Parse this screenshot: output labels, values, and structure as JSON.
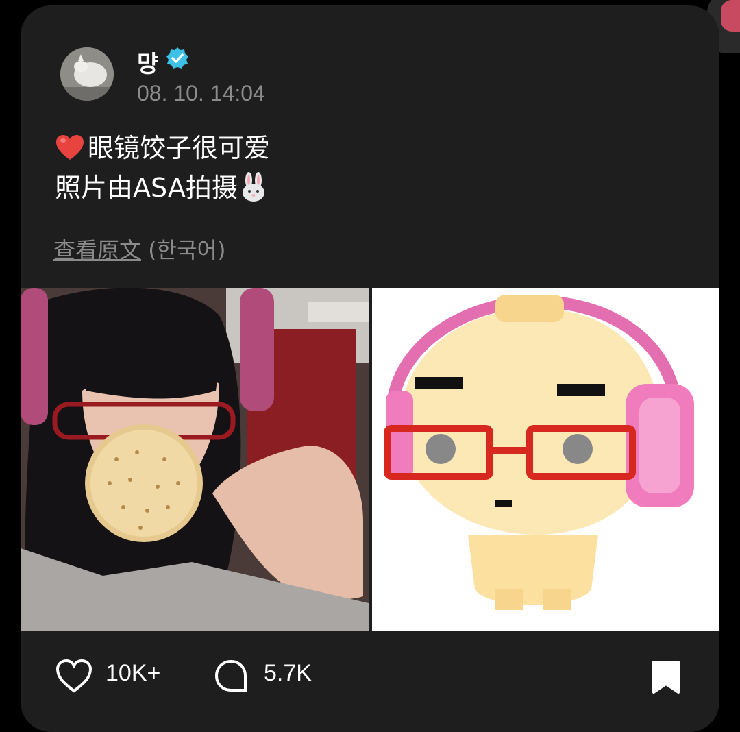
{
  "post": {
    "username": "먕",
    "verified_icon": "verified-badge-icon",
    "timestamp": "08. 10. 14:04",
    "text_line1": "眼镜饺子很可爱",
    "text_line2": "照片由ASA拍摄",
    "emoji_heart": "❤️",
    "emoji_rabbit": "🐰",
    "translate_link": "查看原文",
    "translate_language": "(한국어)"
  },
  "images": [
    {
      "name": "photo-girl-with-cracker"
    },
    {
      "name": "pixel-art-dumpling-character"
    }
  ],
  "actions": {
    "like_icon": "heart-outline-icon",
    "like_count": "10K+",
    "comment_icon": "comment-bubble-icon",
    "comment_count": "5.7K",
    "bookmark_icon": "bookmark-icon"
  },
  "colors": {
    "background": "#000000",
    "card": "#1e1e1e",
    "muted_text": "#8b8b8b",
    "verified": "#3ec1e6"
  }
}
